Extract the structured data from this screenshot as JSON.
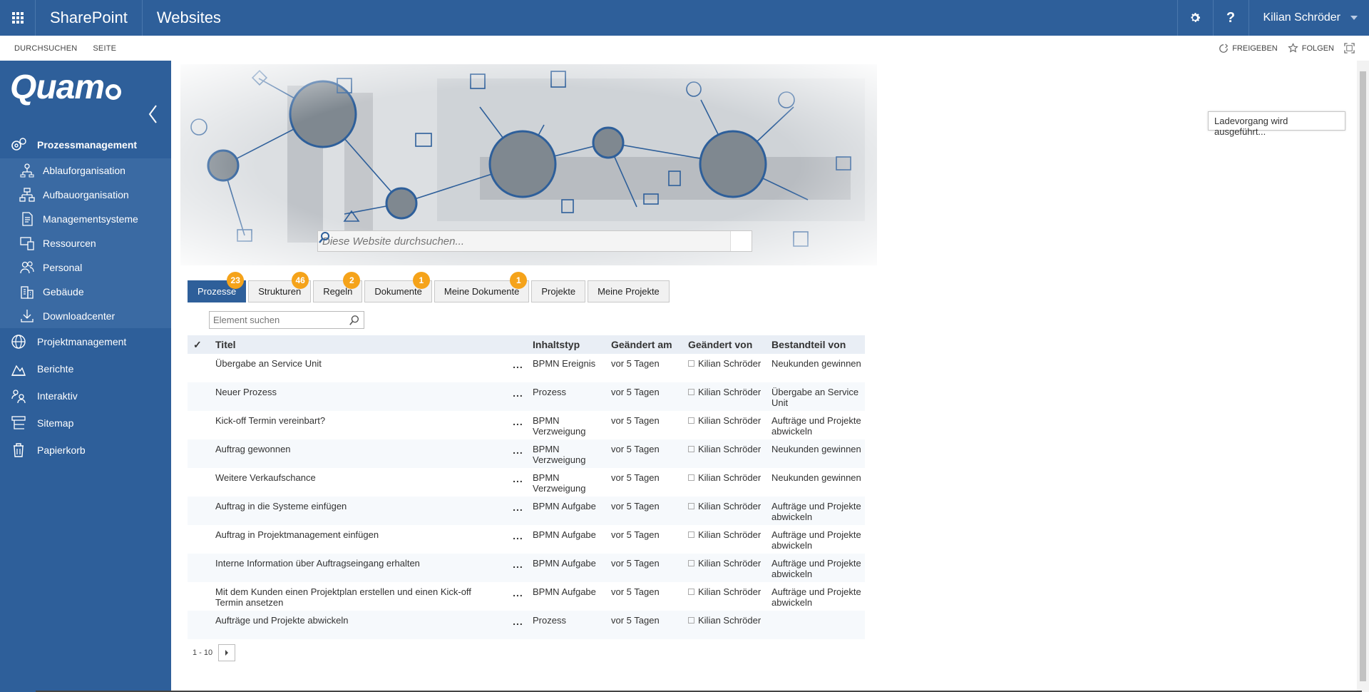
{
  "suitebar": {
    "app_name": "SharePoint",
    "site_name": "Websites",
    "user_name": "Kilian Schröder",
    "help_label": "?"
  },
  "ribbon": {
    "tabs": [
      "DURCHSUCHEN",
      "SEITE"
    ],
    "share_label": "FREIGEBEN",
    "follow_label": "FOLGEN"
  },
  "logo": {
    "text": "Quam"
  },
  "nav": {
    "items": [
      {
        "label": "Prozessmanagement",
        "icon": "gears-icon"
      },
      {
        "label": "Projektmanagement",
        "icon": "globe-icon"
      },
      {
        "label": "Berichte",
        "icon": "chart-area-icon"
      },
      {
        "label": "Interaktiv",
        "icon": "people-icon"
      },
      {
        "label": "Sitemap",
        "icon": "sitemap-icon"
      },
      {
        "label": "Papierkorb",
        "icon": "trash-icon"
      }
    ],
    "sub": [
      {
        "label": "Ablauforganisation",
        "icon": "flow-icon"
      },
      {
        "label": "Aufbauorganisation",
        "icon": "org-chart-icon"
      },
      {
        "label": "Managementsysteme",
        "icon": "document-icon"
      },
      {
        "label": "Ressourcen",
        "icon": "devices-icon"
      },
      {
        "label": "Personal",
        "icon": "people-icon"
      },
      {
        "label": "Gebäude",
        "icon": "building-icon"
      },
      {
        "label": "Downloadcenter",
        "icon": "download-icon"
      }
    ]
  },
  "search": {
    "placeholder": "Diese Website durchsuchen..."
  },
  "status": {
    "loading": "Ladevorgang wird ausgeführt..."
  },
  "tabs": [
    {
      "label": "Prozesse",
      "badge": "23"
    },
    {
      "label": "Strukturen",
      "badge": "46"
    },
    {
      "label": "Regeln",
      "badge": "2"
    },
    {
      "label": "Dokumente",
      "badge": "1"
    },
    {
      "label": "Meine Dokumente",
      "badge": "1"
    },
    {
      "label": "Projekte",
      "badge": ""
    },
    {
      "label": "Meine Projekte",
      "badge": ""
    }
  ],
  "filter": {
    "placeholder": "Element suchen"
  },
  "table": {
    "check_header": "✓",
    "columns": [
      "Titel",
      "Inhaltstyp",
      "Geändert am",
      "Geändert von",
      "Bestandteil von"
    ],
    "menu_label": "...",
    "rows": [
      {
        "title": "Übergabe an Service Unit",
        "type": "BPMN Ereignis",
        "date": "vor 5 Tagen",
        "by": "Kilian Schröder",
        "part": "Neukunden gewinnen"
      },
      {
        "title": "Neuer Prozess",
        "type": "Prozess",
        "date": "vor 5 Tagen",
        "by": "Kilian Schröder",
        "part": "Übergabe an Service Unit"
      },
      {
        "title": "Kick-off Termin vereinbart?",
        "type": "BPMN Verzweigung",
        "date": "vor 5 Tagen",
        "by": "Kilian Schröder",
        "part": "Aufträge und Projekte abwickeln"
      },
      {
        "title": "Auftrag gewonnen",
        "type": "BPMN Verzweigung",
        "date": "vor 5 Tagen",
        "by": "Kilian Schröder",
        "part": "Neukunden gewinnen"
      },
      {
        "title": "Weitere Verkaufschance",
        "type": "BPMN Verzweigung",
        "date": "vor 5 Tagen",
        "by": "Kilian Schröder",
        "part": "Neukunden gewinnen"
      },
      {
        "title": "Auftrag in die Systeme einfügen",
        "type": "BPMN Aufgabe",
        "date": "vor 5 Tagen",
        "by": "Kilian Schröder",
        "part": "Aufträge und Projekte abwickeln"
      },
      {
        "title": "Auftrag in Projektmanagement einfügen",
        "type": "BPMN Aufgabe",
        "date": "vor 5 Tagen",
        "by": "Kilian Schröder",
        "part": "Aufträge und Projekte abwickeln"
      },
      {
        "title": "Interne Information über Auftragseingang erhalten",
        "type": "BPMN Aufgabe",
        "date": "vor 5 Tagen",
        "by": "Kilian Schröder",
        "part": "Aufträge und Projekte abwickeln"
      },
      {
        "title": "Mit dem Kunden einen Projektplan erstellen und einen Kick-off Termin ansetzen",
        "type": "BPMN Aufgabe",
        "date": "vor 5 Tagen",
        "by": "Kilian Schröder",
        "part": "Aufträge und Projekte abwickeln"
      },
      {
        "title": "Aufträge und Projekte abwickeln",
        "type": "Prozess",
        "date": "vor 5 Tagen",
        "by": "Kilian Schröder",
        "part": ""
      }
    ]
  },
  "pager": {
    "range": "1 - 10"
  },
  "colors": {
    "brand": "#2e5f9a",
    "badge": "#f5a31a"
  }
}
